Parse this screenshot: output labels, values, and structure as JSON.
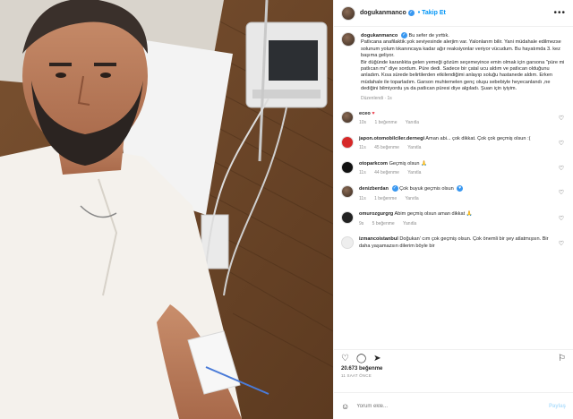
{
  "post": {
    "username": "dogukanmanco",
    "follow_label": "Takip Et",
    "more_label": "•••",
    "caption_lines": [
      "Bu sefer de yırttık.",
      "Patlıcana anafilaktik şok seviyesinde alerjim var. Yalonlarım bilir. Yani müdahale edilmezse solunum yolum tıkanıncaya kadar ağır reaksiyonlar veriyor vücudum. Bu hayatımda 3. kez başıma geliyor.",
      "Bir düğünde karanlıkta gelen yemeği gözüm seçemeyince emin olmak için garsona \"püre mi patlıcan mı\" diye sordum. Püre dedi. Sadece bir çatal ucu aldım ve patlıcan olduğunu anladım. Kısa sürede belirtilerden etkilendiğimi anlayıp soluğu hastanede aldım. Erken müdahale ile toparladım. Garson muhtemelen genç oluşu sebebiyle heyecanlandı ,ne dediğini bilmiyordu ya da patlıcan püresi diye algıladı. Şuan için iyiyim."
    ],
    "caption_meta": "Düzenlendi · 1s"
  },
  "comments": [
    {
      "user": "eceo",
      "text": "♥",
      "time": "10s",
      "likes": "1 beğenme",
      "reply": "Yanıtla"
    },
    {
      "user": "japon.otomobilciler.dernegi",
      "text": "Aman abi... çok dikkat. Çok çok geçmiş olsun :(",
      "time": "11s",
      "likes": "45 beğenme",
      "reply": "Yanıtla"
    },
    {
      "user": "otoparkcom",
      "text": "Geçmiş olsun 🙏",
      "time": "11s",
      "likes": "44 beğenme",
      "reply": "Yanıtla"
    },
    {
      "user": "denizberdan",
      "text": "Çok buyuk geçmis olsun",
      "time": "11s",
      "likes": "1 beğenme",
      "reply": "Yanıtla"
    },
    {
      "user": "omurozgurgrg",
      "text": "Abim geçmiş olsun aman dikkat 🙏",
      "time": "9s",
      "likes": "5 beğenme",
      "reply": "Yanıtla"
    },
    {
      "user": "izmancoistanbul",
      "text": "Doğukan' cım çok geçmiş olsun. Çok önemli bir şey atlatmışsın. Bir daha yaşamazsın dilerim böyle bir",
      "time": "",
      "likes": "",
      "reply": ""
    }
  ],
  "footer": {
    "likes": "20.673 beğenme",
    "date": "11 SAAT ÖNCE",
    "comment_placeholder": "Yorum ekle...",
    "share_label": "Paylaş"
  },
  "icons": {
    "like": "heart-icon",
    "comment": "comment-icon",
    "share": "send-icon",
    "save": "bookmark-icon",
    "emoji": "smiley-icon"
  },
  "colors": {
    "accent": "#0095f6",
    "verified": "#3897f0",
    "muted": "#8e8e8e"
  }
}
